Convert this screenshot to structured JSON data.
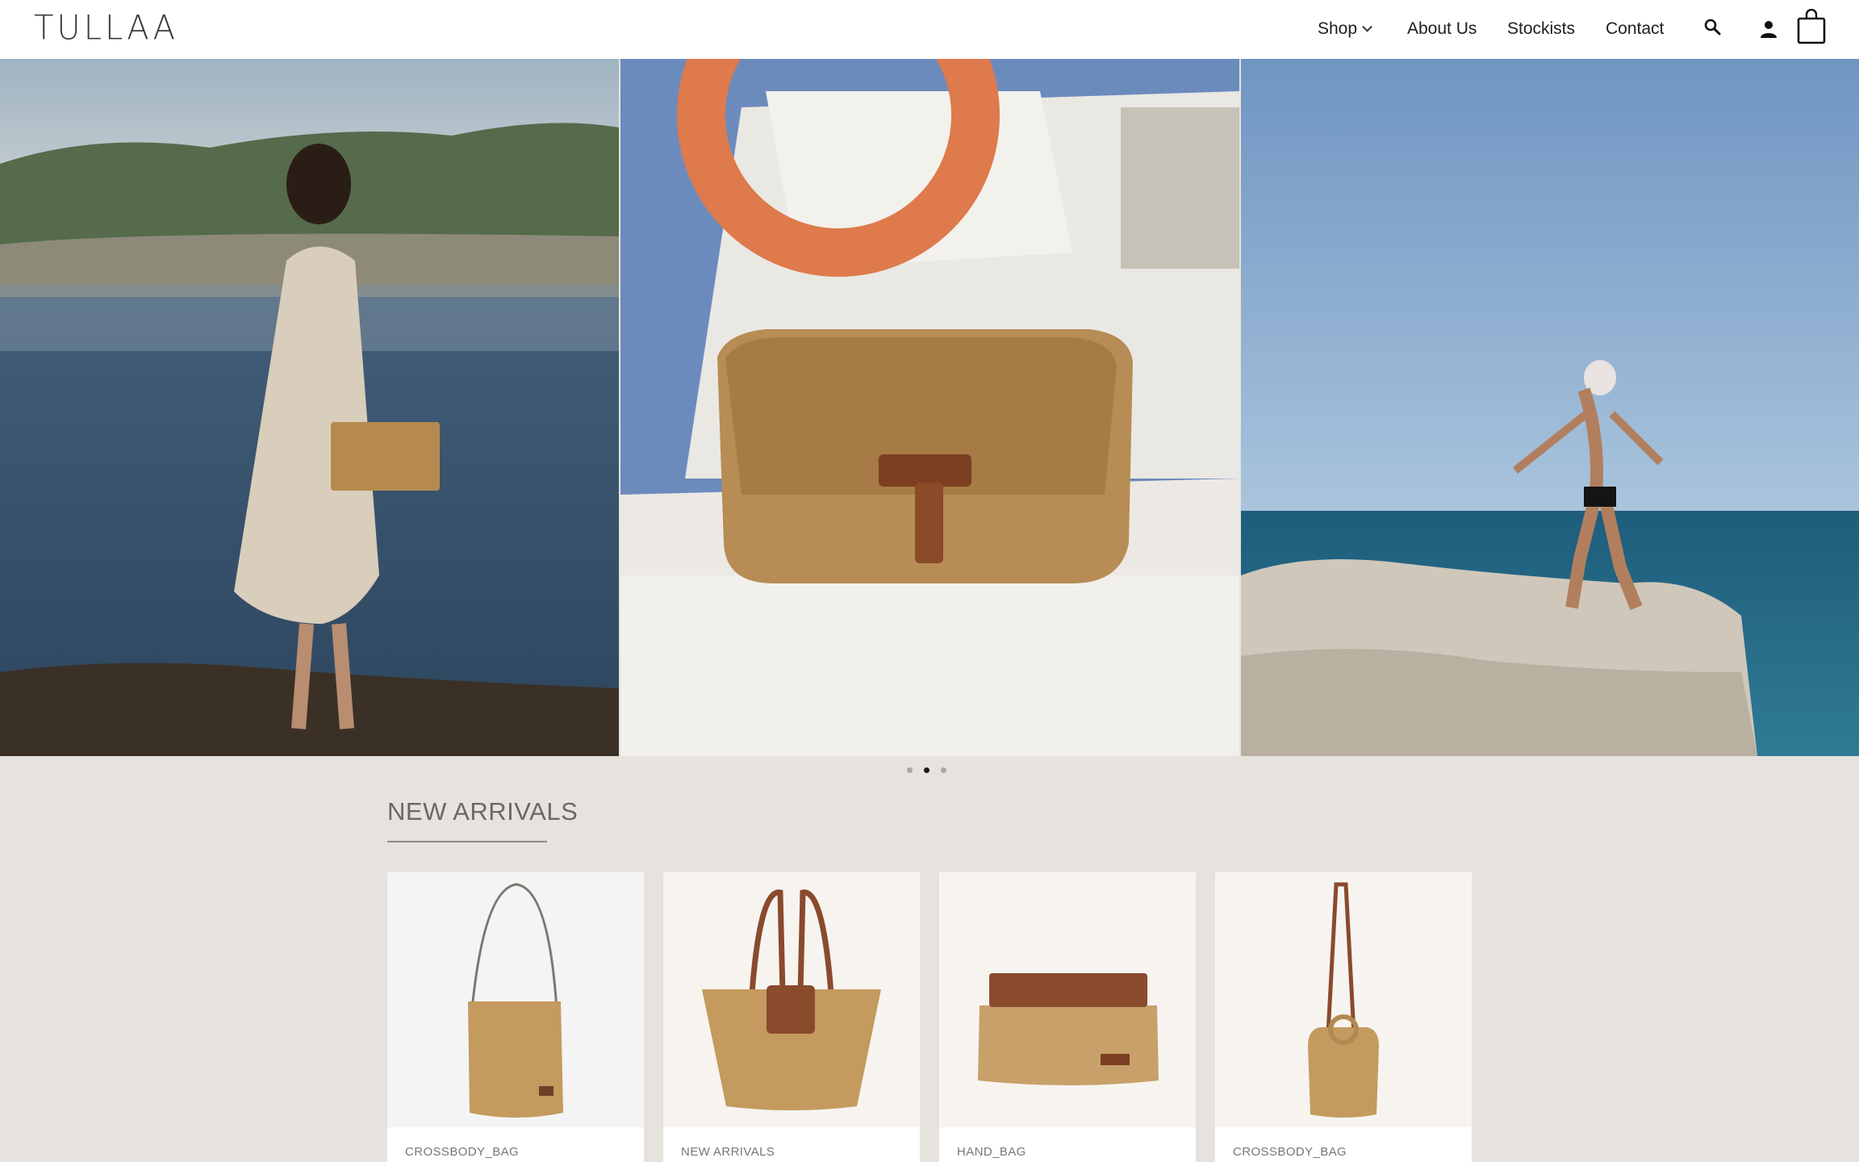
{
  "brand": {
    "logo": "TULLAA"
  },
  "nav": {
    "shop": "Shop",
    "about": "About Us",
    "stockists": "Stockists",
    "contact": "Contact"
  },
  "icons": {
    "search": "search-icon",
    "account": "user-icon",
    "cart": "shopping-bag-icon",
    "dropdown": "chevron-down-icon"
  },
  "hero": {
    "slides": 3,
    "active_slide": 2
  },
  "new_arrivals": {
    "title": "NEW ARRIVALS",
    "products": [
      {
        "category": "CROSSBODY_BAG"
      },
      {
        "category": "NEW ARRIVALS"
      },
      {
        "category": "HAND_BAG"
      },
      {
        "category": "CROSSBODY_BAG"
      }
    ]
  },
  "colors": {
    "header_bg": "#ffffff",
    "page_bg": "#e6e3de",
    "raffia": "#c49a5e",
    "leather": "#8a4a2c"
  }
}
